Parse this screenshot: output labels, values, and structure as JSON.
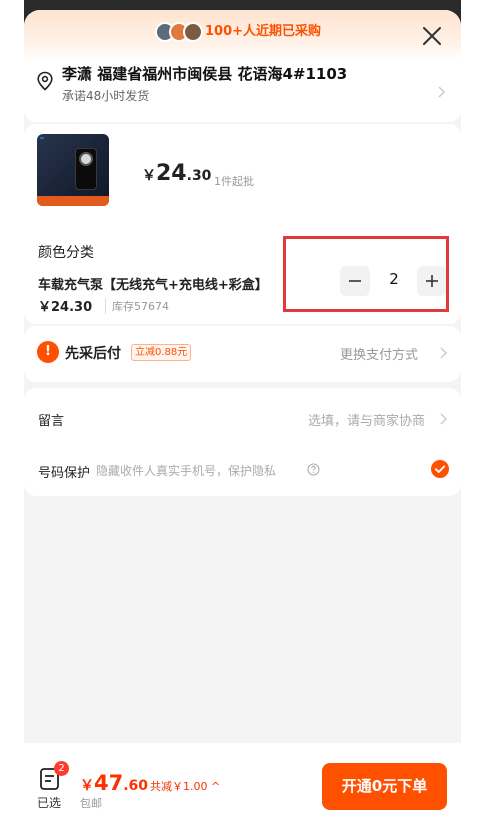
{
  "header": {
    "recent_purchase": "100+人近期已采购"
  },
  "address": {
    "full": "李潇 福建省福州市闽侯县 花语海4#1103",
    "shipping_promise": "承诺48小时发货"
  },
  "product": {
    "price_yen": "￥",
    "price_int": "24",
    "price_dec": ".30",
    "min_batch": "1件起批",
    "color_category_label": "颜色分类",
    "variant_name": "车载充气泵【无线充气+充电线+彩盒】",
    "variant_price": "￥24.30",
    "stock": "库存57674",
    "quantity": "2"
  },
  "payment": {
    "icon_glyph": "!",
    "label": "先采后付",
    "discount": "立减0.88元",
    "change": "更换支付方式"
  },
  "remark": {
    "label": "留言",
    "hint": "选填，请与商家协商"
  },
  "phone_protect": {
    "label": "号码保护",
    "hint": "隐藏收件人真实手机号，保护隐私"
  },
  "bottom": {
    "cart_count": "2",
    "cart_label": "已选",
    "total_yen": "￥",
    "total_int": "47",
    "total_dec": ".60",
    "saved": "共减￥1.00 ^",
    "shipping": "包邮",
    "order_button": "开通0元下单"
  },
  "colors": {
    "accent": "#ff5000",
    "price_red": "#ff3000",
    "highlight": "#e23a3a"
  },
  "icons": [
    "close-icon",
    "location-pin-icon",
    "chevron-right-icon",
    "minus-icon",
    "plus-icon",
    "help-circle-icon",
    "check-circle-icon",
    "cart-list-icon"
  ]
}
